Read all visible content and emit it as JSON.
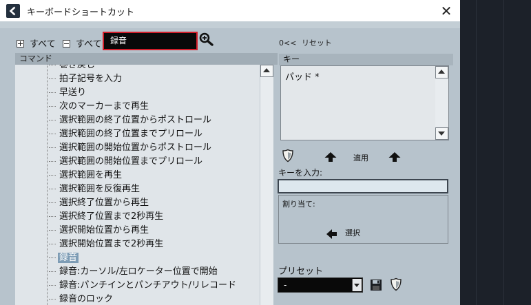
{
  "window": {
    "title": "キーボードショートカット",
    "close_glyph": "✕"
  },
  "toolbar": {
    "expand_all_label": "すべて",
    "collapse_all_label": "すべて",
    "search_value": "録音"
  },
  "commands": {
    "header": "コマンド",
    "items": [
      {
        "label": "巻き戻し"
      },
      {
        "label": "拍子記号を入力"
      },
      {
        "label": "早送り"
      },
      {
        "label": "次のマーカーまで再生"
      },
      {
        "label": "選択範囲の終了位置からポストロール"
      },
      {
        "label": "選択範囲の終了位置までプリロール"
      },
      {
        "label": "選択範囲の開始位置からポストロール"
      },
      {
        "label": "選択範囲の開始位置までプリロール"
      },
      {
        "label": "選択範囲を再生"
      },
      {
        "label": "選択範囲を反復再生"
      },
      {
        "label": "選択終了位置から再生"
      },
      {
        "label": "選択終了位置まで2秒再生"
      },
      {
        "label": "選択開始位置から再生"
      },
      {
        "label": "選択開始位置まで2秒再生"
      },
      {
        "label": "録音",
        "selected": true
      },
      {
        "label": "録音:カーソル/左ロケーター位置で開始"
      },
      {
        "label": "録音:パンチインとパンチアウト/リレコード"
      },
      {
        "label": "録音のロック"
      }
    ]
  },
  "keys": {
    "reset_prefix": "0<<",
    "reset_label": "リセット",
    "header": "キー",
    "items": [
      "パッド *"
    ],
    "apply_label": "適用",
    "input_label": "キーを入力:",
    "input_value": "",
    "assigned_label": "割り当て:",
    "select_label": "選択"
  },
  "preset": {
    "label": "プリセット",
    "value": "-"
  },
  "colors": {
    "accent_border": "#d31e2a",
    "panel_bg": "#b7c3cc",
    "selection": "#7d9cb5"
  }
}
